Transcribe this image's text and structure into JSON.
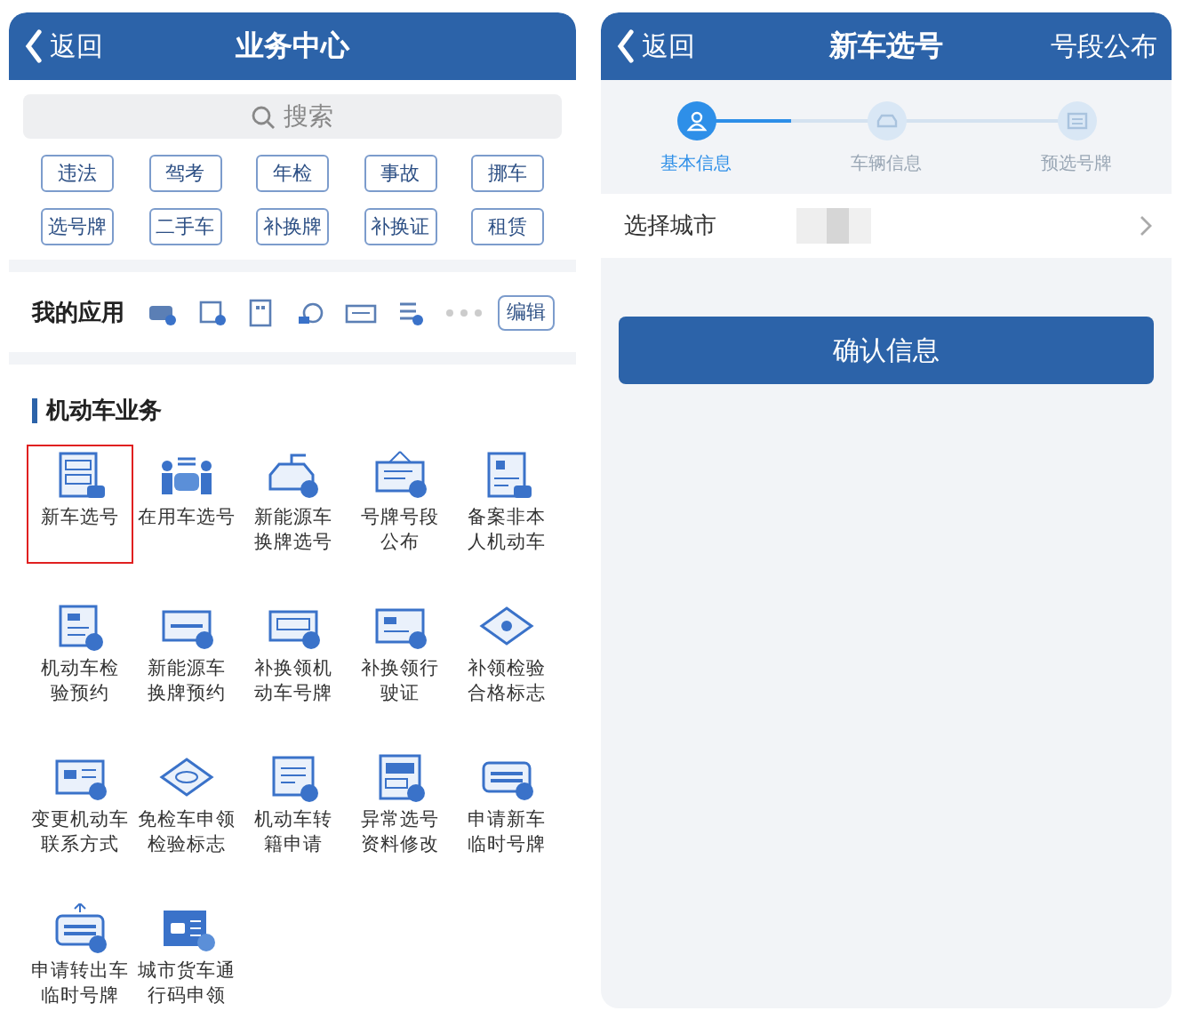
{
  "left": {
    "header": {
      "back": "返回",
      "title": "业务中心"
    },
    "search": {
      "placeholder": "搜索"
    },
    "tags": [
      "违法",
      "驾考",
      "年检",
      "事故",
      "挪车",
      "选号牌",
      "二手车",
      "补换牌",
      "补换证",
      "租赁"
    ],
    "my_apps": {
      "title": "我的应用",
      "edit": "编辑"
    },
    "section": {
      "title": "机动车业务",
      "items": [
        {
          "lines": [
            "新车选号"
          ],
          "selected": true
        },
        {
          "lines": [
            "在用车选号"
          ],
          "selected": false
        },
        {
          "lines": [
            "新能源车",
            "换牌选号"
          ],
          "selected": false
        },
        {
          "lines": [
            "号牌号段",
            "公布"
          ],
          "selected": false
        },
        {
          "lines": [
            "备案非本",
            "人机动车"
          ],
          "selected": false
        },
        {
          "lines": [
            "机动车检",
            "验预约"
          ],
          "selected": false
        },
        {
          "lines": [
            "新能源车",
            "换牌预约"
          ],
          "selected": false
        },
        {
          "lines": [
            "补换领机",
            "动车号牌"
          ],
          "selected": false
        },
        {
          "lines": [
            "补换领行",
            "驶证"
          ],
          "selected": false
        },
        {
          "lines": [
            "补领检验",
            "合格标志"
          ],
          "selected": false
        },
        {
          "lines": [
            "变更机动车",
            "联系方式"
          ],
          "selected": false
        },
        {
          "lines": [
            "免检车申领",
            "检验标志"
          ],
          "selected": false
        },
        {
          "lines": [
            "机动车转",
            "籍申请"
          ],
          "selected": false
        },
        {
          "lines": [
            "异常选号",
            "资料修改"
          ],
          "selected": false
        },
        {
          "lines": [
            "申请新车",
            "临时号牌"
          ],
          "selected": false
        },
        {
          "lines": [
            "申请转出车",
            "临时号牌"
          ],
          "selected": false
        },
        {
          "lines": [
            "城市货车通",
            "行码申领"
          ],
          "selected": false
        }
      ]
    }
  },
  "right": {
    "header": {
      "back": "返回",
      "title": "新车选号",
      "action": "号段公布"
    },
    "steps": [
      {
        "label": "基本信息",
        "active": true
      },
      {
        "label": "车辆信息",
        "active": false
      },
      {
        "label": "预选号牌",
        "active": false
      }
    ],
    "field": {
      "label": "选择城市"
    },
    "confirm": "确认信息"
  }
}
